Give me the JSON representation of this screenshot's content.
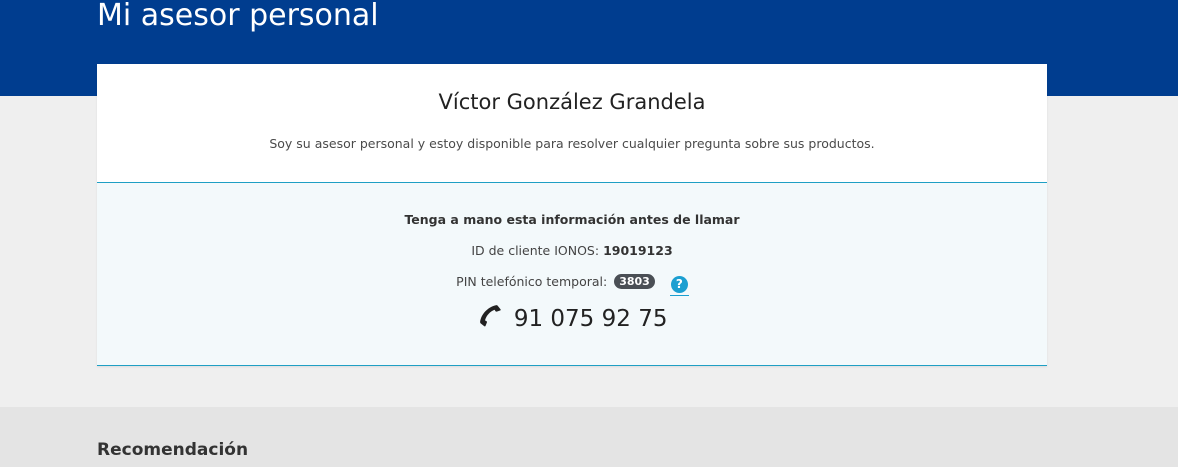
{
  "header": {
    "title": "Mi asesor personal"
  },
  "advisor": {
    "name": "Víctor González Grandela",
    "description": "Soy su asesor personal y estoy disponible para resolver cualquier pregunta sobre sus productos."
  },
  "contact_info": {
    "heading": "Tenga a mano esta información antes de llamar",
    "client_id_label": "ID de cliente IONOS:",
    "client_id_value": "19019123",
    "pin_label": "PIN telefónico temporal:",
    "pin_value": "3803",
    "help_label": "?",
    "phone_number": "91 075 92 75",
    "phone_icon": "phone-icon"
  },
  "recommendation": {
    "title": "Recomendación"
  },
  "colors": {
    "header_bg": "#003d8f",
    "accent_line": "#1e9fc4",
    "help_icon": "#1b9fd1",
    "pin_badge": "#4a4f55",
    "info_panel_bg": "#f3f9fb"
  }
}
